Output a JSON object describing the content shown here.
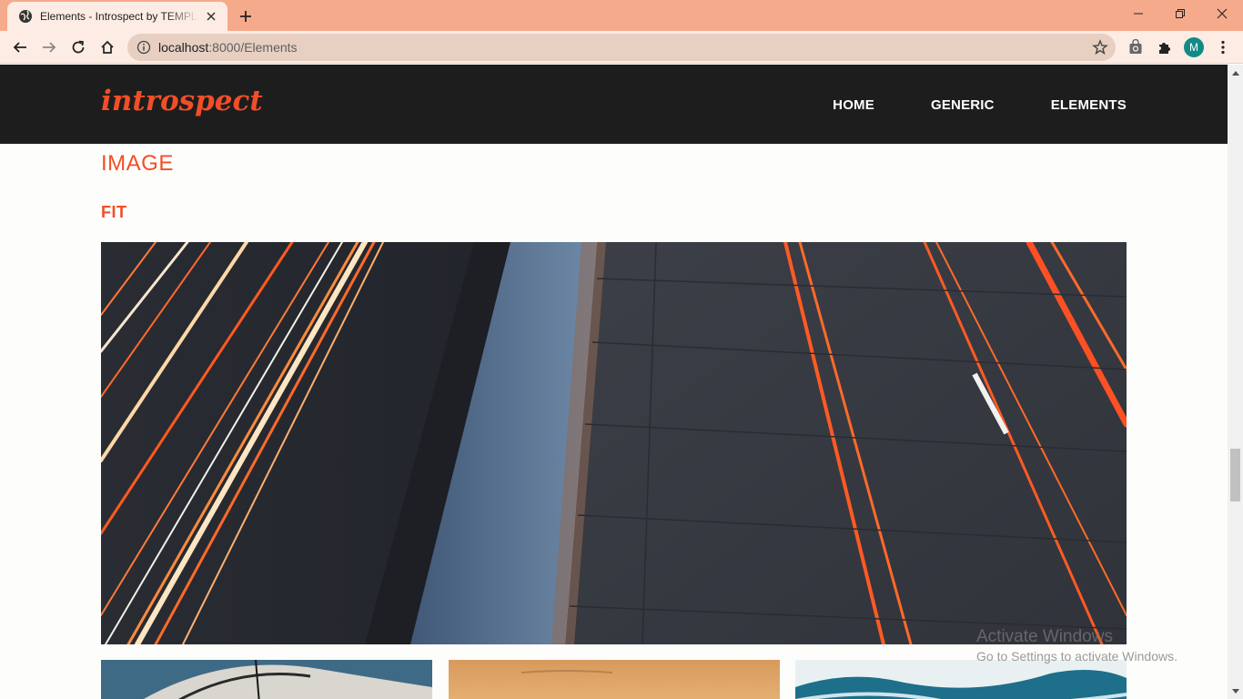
{
  "browser": {
    "tab_title": "Elements - Introspect by TEMPLATED",
    "url_host": "localhost",
    "url_port": ":8000",
    "url_path": "/Elements",
    "profile_initial": "M",
    "colors": {
      "tabbar": "#f6aa8c",
      "toolbar": "#fdece4",
      "avatar": "#128a86"
    }
  },
  "site": {
    "logo": "introspect",
    "nav": [
      {
        "label": "HOME"
      },
      {
        "label": "GENERIC"
      },
      {
        "label": "ELEMENTS"
      }
    ],
    "colors": {
      "accent": "#f24e27",
      "header_bg": "#1d1d1d"
    }
  },
  "content": {
    "heading": "IMAGE",
    "subheading": "FIT"
  },
  "watermark": {
    "title": "Activate Windows",
    "subtitle": "Go to Settings to activate Windows."
  }
}
